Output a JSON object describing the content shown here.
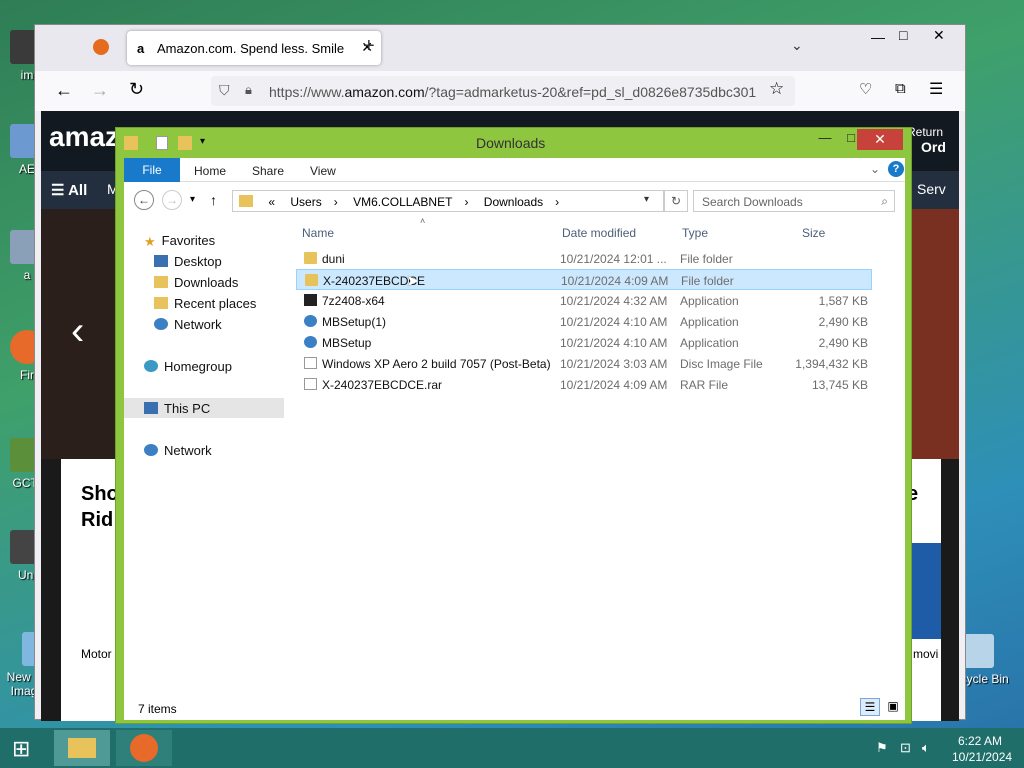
{
  "desktop": {
    "icons": [
      {
        "label": "im",
        "color": "#3a3a3a"
      },
      {
        "label": "AE",
        "color": "#6c9ad0"
      },
      {
        "label": "a",
        "color": "#8aa0b8"
      },
      {
        "label": "Fir",
        "color": "#e86a2a"
      },
      {
        "label": "GCTr",
        "color": "#5b8f3a"
      },
      {
        "label": "Uni",
        "color": "#444"
      },
      {
        "label": "New Bitmap Image.png",
        "color": "#7fb7e0"
      },
      {
        "label": "Recycle Bin",
        "color": "#b8d4e8"
      }
    ]
  },
  "browser": {
    "tab_title": "Amazon.com. Spend less. Smile",
    "url_prefix": "https://www.",
    "url_host": "amazon.com",
    "url_rest": "/?tag=admarketus-20&ref=pd_sl_d0826e8735dbc301",
    "page": {
      "logo": "amaz",
      "nav_all": "All",
      "nav_m": "M",
      "return_text": "Return",
      "orders_text": "Ord",
      "serv_text": "Serv",
      "card_title_1": "Sho",
      "card_title_2": "Rid",
      "card_right": "e",
      "motor_text": "Motor",
      "movi_text": "movi"
    }
  },
  "explorer": {
    "title": "Downloads",
    "ribbon": {
      "file": "File",
      "home": "Home",
      "share": "Share",
      "view": "View"
    },
    "address": {
      "chevrons": "«",
      "crumbs": [
        "Users",
        "VM6.COLLABNET",
        "Downloads"
      ]
    },
    "search_placeholder": "Search Downloads",
    "nav": {
      "favorites": "Favorites",
      "desktop": "Desktop",
      "downloads": "Downloads",
      "recent": "Recent places",
      "network1": "Network",
      "homegroup": "Homegroup",
      "thispc": "This PC",
      "network2": "Network"
    },
    "columns": {
      "name": "Name",
      "date": "Date modified",
      "type": "Type",
      "size": "Size"
    },
    "files": [
      {
        "name": "duni",
        "date": "10/21/2024 12:01 ...",
        "type": "File folder",
        "size": "",
        "icon": "folder"
      },
      {
        "name": "X-240237EBCDCE",
        "date": "10/21/2024 4:09 AM",
        "type": "File folder",
        "size": "",
        "icon": "folder"
      },
      {
        "name": "7z2408-x64",
        "date": "10/21/2024 4:32 AM",
        "type": "Application",
        "size": "1,587 KB",
        "icon": "zip"
      },
      {
        "name": "MBSetup(1)",
        "date": "10/21/2024 4:10 AM",
        "type": "Application",
        "size": "2,490 KB",
        "icon": "app"
      },
      {
        "name": "MBSetup",
        "date": "10/21/2024 4:10 AM",
        "type": "Application",
        "size": "2,490 KB",
        "icon": "app"
      },
      {
        "name": "Windows XP Aero 2 build 7057 (Post-Beta)",
        "date": "10/21/2024 3:03 AM",
        "type": "Disc Image File",
        "size": "1,394,432 KB",
        "icon": "doc"
      },
      {
        "name": "X-240237EBCDCE.rar",
        "date": "10/21/2024 4:09 AM",
        "type": "RAR File",
        "size": "13,745 KB",
        "icon": "doc"
      }
    ],
    "status": "7 items"
  },
  "taskbar": {
    "time": "6:22 AM",
    "date": "10/21/2024"
  }
}
